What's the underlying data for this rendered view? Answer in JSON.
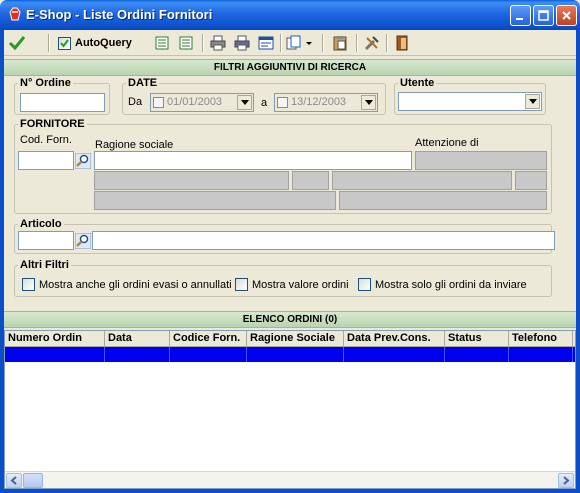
{
  "window": {
    "title": "E-Shop - Liste Ordini Fornitori",
    "controls": [
      "minimize",
      "maximize",
      "close"
    ]
  },
  "toolbar": {
    "confirm_icon": "checkmark-icon",
    "autoquery_label": "AutoQuery",
    "autoquery_checked": true,
    "buttons": [
      "export-excel-icon",
      "export-excel-2-icon",
      "print-icon",
      "print-preview-icon",
      "report-icon",
      "copy-dropdown-icon",
      "clipboard-icon",
      "tools-icon",
      "exit-icon"
    ]
  },
  "filters": {
    "header": "FILTRI AGGIUNTIVI DI RICERCA",
    "order_number": {
      "legend": "N° Ordine",
      "value": ""
    },
    "date": {
      "legend": "DATE",
      "from_label": "Da",
      "from_value": "01/01/2003",
      "to_label": "a",
      "to_value": "13/12/2003"
    },
    "user": {
      "legend": "Utente",
      "value": ""
    },
    "supplier": {
      "legend": "FORNITORE",
      "code_label": "Cod. Forn.",
      "name_label": "Ragione sociale",
      "attention_label": "Attenzione di",
      "code_value": "",
      "name_value": ""
    },
    "article": {
      "legend": "Articolo",
      "code_value": "",
      "description_value": ""
    },
    "other": {
      "legend": "Altri Filtri",
      "options": [
        {
          "label": "Mostra anche gli ordini evasi o annullati",
          "checked": false
        },
        {
          "label": "Mostra valore ordini",
          "checked": false
        },
        {
          "label": "Mostra solo gli ordini da inviare",
          "checked": false
        }
      ]
    }
  },
  "orders": {
    "header": "ELENCO ORDINI (0)",
    "columns": [
      "Numero Ordin",
      "Data",
      "Codice Forn.",
      "Ragione Sociale",
      "Data Prev.Cons.",
      "Status",
      "Telefono",
      "I"
    ]
  },
  "colors": {
    "titlebar": "#0a5fd8",
    "section_header": "#c8dcc0",
    "selected_row": "#0000f0"
  }
}
